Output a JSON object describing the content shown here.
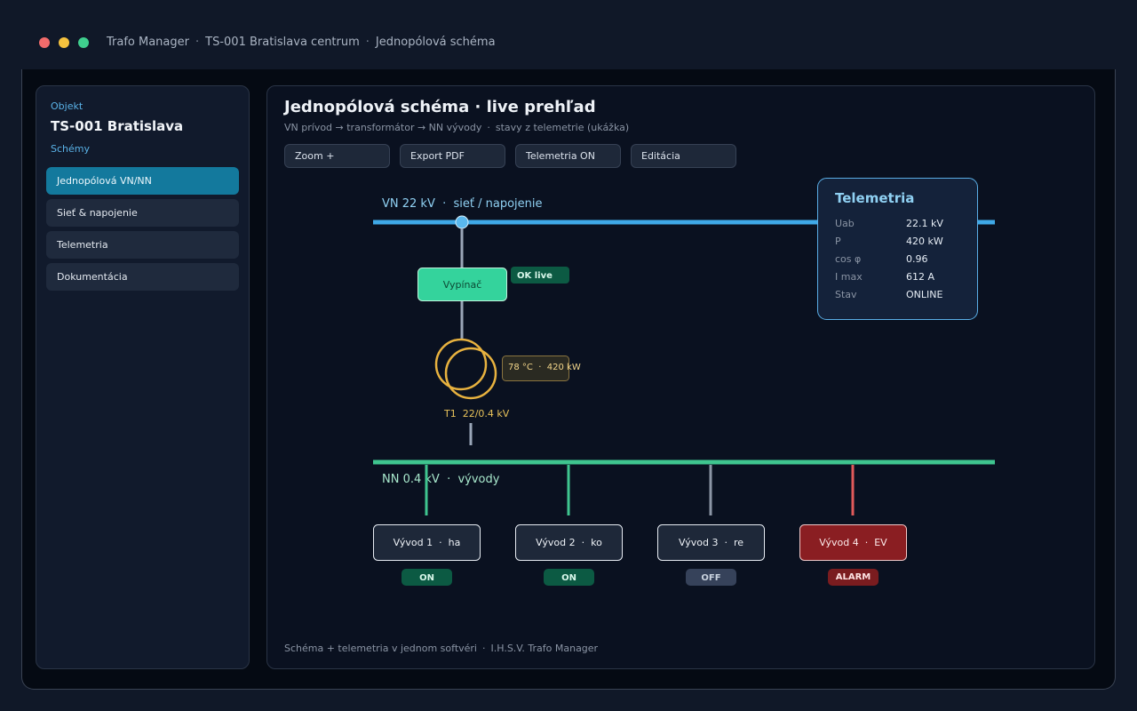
{
  "window": {
    "breadcrumb": [
      "Trafo Manager",
      "TS-001 Bratislava centrum",
      "Jednopólová schéma"
    ],
    "traffic_lights": [
      "close",
      "minimize",
      "maximize"
    ]
  },
  "sidebar": {
    "object_label": "Objekt",
    "object_title": "TS-001 Bratislava",
    "schemes_label": "Schémy",
    "items": [
      {
        "label": "Jednopólová VN/NN",
        "active": true
      },
      {
        "label": "Sieť & napojenie",
        "active": false
      },
      {
        "label": "Telemetria",
        "active": false
      },
      {
        "label": "Dokumentácia",
        "active": false
      }
    ]
  },
  "main": {
    "title": "Jednopólová schéma · live prehľad",
    "subtitle_parts": [
      "VN prívod → transformátor → NN vývody",
      "stavy z telemetrie (ukážka)"
    ],
    "toolbar": [
      "Zoom +",
      "Export PDF",
      "Telemetria ON",
      "Editácia"
    ],
    "footer_parts": [
      "Schéma + telemetria v jednom softvéri",
      "I.H.S.V. Trafo Manager"
    ]
  },
  "diagram": {
    "vn_label": "VN 22 kV  ·  sieť / napojenie",
    "breaker_label": "Vypínač",
    "breaker_badge": "OK live",
    "transformer_info": "78 °C  ·  420 kW",
    "transformer_label": "T1  22/0.4 kV",
    "nn_label": "NN 0.4 kV  ·  vývody",
    "feeders": [
      {
        "label": "Vývod 1  ·  ha",
        "status": "ON",
        "state": "on"
      },
      {
        "label": "Vývod 2  ·  ko",
        "status": "ON",
        "state": "on"
      },
      {
        "label": "Vývod 3  ·  re",
        "status": "OFF",
        "state": "off"
      },
      {
        "label": "Vývod 4  ·  EV",
        "status": "ALARM",
        "state": "alarm"
      }
    ]
  },
  "telemetry": {
    "title": "Telemetria",
    "rows": [
      {
        "key": "Uab",
        "value": "22.1 kV"
      },
      {
        "key": "P",
        "value": "420 kW"
      },
      {
        "key": "cos φ",
        "value": "0.96"
      },
      {
        "key": "I max",
        "value": "612 A"
      },
      {
        "key": "Stav",
        "value": "ONLINE"
      }
    ]
  },
  "colors": {
    "vn_bus": "#3fa9e8",
    "nn_bus": "#3fc58f",
    "transformer": "#e8b23f",
    "accent": "#13799d",
    "alarm": "#e05a5a",
    "ok": "#0c5a43"
  }
}
